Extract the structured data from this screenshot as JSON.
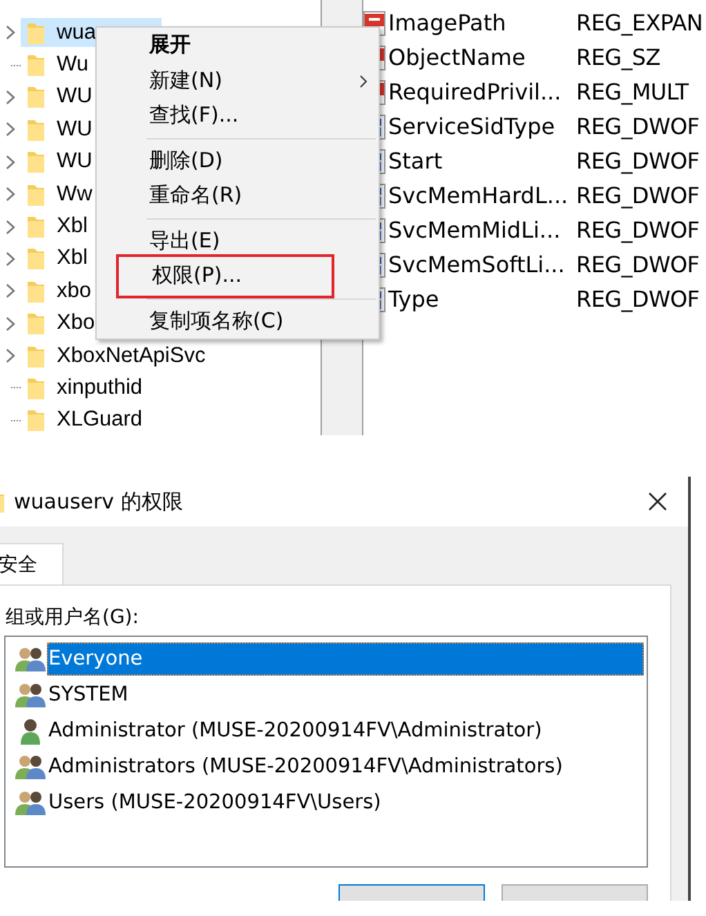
{
  "registry_tree": {
    "items": [
      {
        "label": "wua",
        "expandable": true,
        "selected": true
      },
      {
        "label": "Wu",
        "expandable": false,
        "selected": false
      },
      {
        "label": "WU",
        "expandable": true,
        "selected": false
      },
      {
        "label": "WU",
        "expandable": true,
        "selected": false
      },
      {
        "label": "WU",
        "expandable": true,
        "selected": false
      },
      {
        "label": "Ww",
        "expandable": true,
        "selected": false
      },
      {
        "label": "Xbl",
        "expandable": true,
        "selected": false
      },
      {
        "label": "Xbl",
        "expandable": true,
        "selected": false
      },
      {
        "label": "xbo",
        "expandable": true,
        "selected": false
      },
      {
        "label": "Xbo",
        "expandable": true,
        "selected": false
      },
      {
        "label": "XboxNetApiSvc",
        "expandable": true,
        "selected": false
      },
      {
        "label": "xinputhid",
        "expandable": false,
        "selected": false
      },
      {
        "label": "XLGuard",
        "expandable": false,
        "selected": false
      }
    ]
  },
  "registry_values": {
    "rows": [
      {
        "kind": "string",
        "name": "ImagePath",
        "type": "REG_EXPAN"
      },
      {
        "kind": "string",
        "name": "ObjectName",
        "type": "REG_SZ"
      },
      {
        "kind": "string",
        "name": "RequiredPrivil...",
        "type": "REG_MULT"
      },
      {
        "kind": "binary",
        "name": "ServiceSidType",
        "type": "REG_DWOF"
      },
      {
        "kind": "binary",
        "name": "Start",
        "type": "REG_DWOF"
      },
      {
        "kind": "binary",
        "name": "SvcMemHardL...",
        "type": "REG_DWOF"
      },
      {
        "kind": "binary",
        "name": "SvcMemMidLi...",
        "type": "REG_DWOF"
      },
      {
        "kind": "binary",
        "name": "SvcMemSoftLi...",
        "type": "REG_DWOF"
      },
      {
        "kind": "binary",
        "name": "Type",
        "type": "REG_DWOF"
      }
    ]
  },
  "context_menu": {
    "items": [
      {
        "kind": "item",
        "label": "展开",
        "default": true,
        "submenu": false,
        "highlighted": false
      },
      {
        "kind": "item",
        "label": "新建(N)",
        "default": false,
        "submenu": true,
        "highlighted": false
      },
      {
        "kind": "item",
        "label": "查找(F)...",
        "default": false,
        "submenu": false,
        "highlighted": false
      },
      {
        "kind": "separator"
      },
      {
        "kind": "item",
        "label": "删除(D)",
        "default": false,
        "submenu": false,
        "highlighted": false
      },
      {
        "kind": "item",
        "label": "重命名(R)",
        "default": false,
        "submenu": false,
        "highlighted": false
      },
      {
        "kind": "separator"
      },
      {
        "kind": "item",
        "label": "导出(E)",
        "default": false,
        "submenu": false,
        "highlighted": false
      },
      {
        "kind": "item",
        "label": "权限(P)...",
        "default": false,
        "submenu": false,
        "highlighted": true
      },
      {
        "kind": "separator"
      },
      {
        "kind": "item",
        "label": "复制项名称(C)",
        "default": false,
        "submenu": false,
        "highlighted": false
      }
    ]
  },
  "dialog": {
    "title": "wuauserv 的权限",
    "tabs": [
      {
        "label": "安全",
        "selected": true
      }
    ],
    "group_label": "组或用户名(G):",
    "principals": [
      {
        "kind": "group",
        "name": "Everyone",
        "selected": true
      },
      {
        "kind": "group",
        "name": "SYSTEM",
        "selected": false
      },
      {
        "kind": "user",
        "name": "Administrator (MUSE-20200914FV\\Administrator)",
        "selected": false
      },
      {
        "kind": "group",
        "name": "Administrators (MUSE-20200914FV\\Administrators)",
        "selected": false
      },
      {
        "kind": "group",
        "name": "Users (MUSE-20200914FV\\Users)",
        "selected": false
      }
    ]
  }
}
